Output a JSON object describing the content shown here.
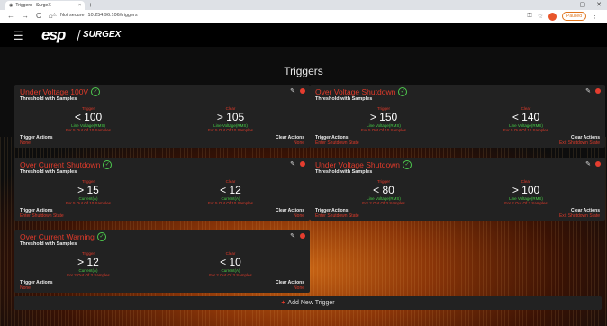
{
  "browser": {
    "tab_title": "Triggers - SurgeX",
    "tab_close": "×",
    "new_tab": "+",
    "window_controls": [
      "–",
      "▢",
      "✕"
    ],
    "nav": [
      "←",
      "→",
      "C",
      "⌂"
    ],
    "security": "Not secure",
    "url": "10.254.96.106/triggers",
    "pause_label": "Paused",
    "star": "☆"
  },
  "header": {
    "menu_icon": "☰",
    "logo_primary": "esp",
    "logo_secondary": "SURGEX"
  },
  "page": {
    "title": "Triggers",
    "add_label": "Add New Trigger",
    "add_icon": "+"
  },
  "cards": [
    {
      "name": "Under Voltage 100V",
      "subtitle": "Threshold with Samples",
      "trigger": {
        "label": "Trigger",
        "value": "< 100",
        "unit": "Line Voltage(RMS)",
        "samples": "For 5 Out Of 10 Samples"
      },
      "clear": {
        "label": "Clear",
        "value": "> 105",
        "unit": "Line Voltage(RMS)",
        "samples": "For 5 Out Of 10 Samples"
      },
      "trigger_actions_label": "Trigger Actions",
      "trigger_actions_value": "None",
      "clear_actions_label": "Clear Actions",
      "clear_actions_value": "None"
    },
    {
      "name": "Over Voltage Shutdown",
      "subtitle": "Threshold with Samples",
      "trigger": {
        "label": "Trigger",
        "value": "> 150",
        "unit": "Line Voltage(RMS)",
        "samples": "For 5 Out Of 10 Samples"
      },
      "clear": {
        "label": "Clear",
        "value": "< 140",
        "unit": "Line Voltage(RMS)",
        "samples": "For 5 Out Of 10 Samples"
      },
      "trigger_actions_label": "Trigger Actions",
      "trigger_actions_value": "Enter Shutdown State",
      "clear_actions_label": "Clear Actions",
      "clear_actions_value": "Exit Shutdown State"
    },
    {
      "name": "Over Current Shutdown",
      "subtitle": "Threshold with Samples",
      "trigger": {
        "label": "Trigger",
        "value": "> 15",
        "unit": "Current(A)",
        "samples": "For 5 Out Of 10 Samples"
      },
      "clear": {
        "label": "Clear",
        "value": "< 12",
        "unit": "Current(A)",
        "samples": "For 5 Out Of 10 Samples"
      },
      "trigger_actions_label": "Trigger Actions",
      "trigger_actions_value": "Enter Shutdown State",
      "clear_actions_label": "Clear Actions",
      "clear_actions_value": "None"
    },
    {
      "name": "Under Voltage Shutdown",
      "subtitle": "Threshold with Samples",
      "trigger": {
        "label": "Trigger",
        "value": "< 80",
        "unit": "Line Voltage(RMS)",
        "samples": "For 2 Out Of 3 Samples"
      },
      "clear": {
        "label": "Clear",
        "value": "> 100",
        "unit": "Line Voltage(RMS)",
        "samples": "For 2 Out Of 3 Samples"
      },
      "trigger_actions_label": "Trigger Actions",
      "trigger_actions_value": "Enter Shutdown State",
      "clear_actions_label": "Clear Actions",
      "clear_actions_value": "Exit Shutdown State"
    },
    {
      "name": "Over Current Warning",
      "subtitle": "Threshold with Samples",
      "trigger": {
        "label": "Trigger",
        "value": "> 12",
        "unit": "Current(A)",
        "samples": "For 2 Out Of 3 Samples"
      },
      "clear": {
        "label": "Clear",
        "value": "< 10",
        "unit": "Current(A)",
        "samples": "For 2 Out Of 3 Samples"
      },
      "trigger_actions_label": "Trigger Actions",
      "trigger_actions_value": "None",
      "clear_actions_label": "Clear Actions",
      "clear_actions_value": "None"
    }
  ],
  "icons": {
    "edit": "pencil-icon",
    "delete": "delete-dot-icon",
    "status": "check-circle-icon"
  },
  "colors": {
    "accent_red": "#e03a2a",
    "ok_green": "#47d147",
    "card_bg": "#222222"
  }
}
